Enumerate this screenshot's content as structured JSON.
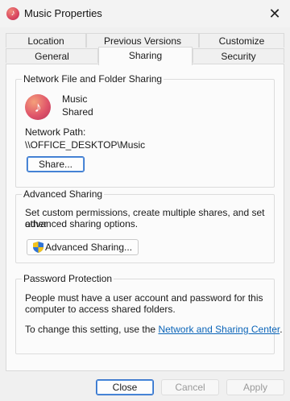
{
  "window": {
    "title": "Music Properties",
    "app_icon": "music-note-icon",
    "close_glyph": "✕"
  },
  "tabs": {
    "row_top": [
      "Location",
      "Previous Versions",
      "Customize"
    ],
    "row_bottom": [
      "General",
      "Sharing",
      "Security"
    ],
    "active": "Sharing"
  },
  "network_sharing": {
    "group_title": "Network File and Folder Sharing",
    "folder_name": "Music",
    "status": "Shared",
    "path_label": "Network Path:",
    "path_value": "\\\\OFFICE_DESKTOP\\Music",
    "share_button": "Share..."
  },
  "advanced_sharing": {
    "group_title": "Advanced Sharing",
    "description_line1": "Set custom permissions, create multiple shares, and set other",
    "description_line2": "advanced sharing options.",
    "button": "Advanced Sharing..."
  },
  "password_protection": {
    "group_title": "Password Protection",
    "line1": "People must have a user account and password for this",
    "line2": "computer to access shared folders.",
    "change_text": "To change this setting, use the ",
    "link_text": "Network and Sharing Center",
    "period": "."
  },
  "footer": {
    "close": "Close",
    "cancel": "Cancel",
    "apply": "Apply"
  },
  "colors": {
    "accent": "#2f6fc9",
    "link": "#0a64b8",
    "background": "#f0f0f0"
  }
}
